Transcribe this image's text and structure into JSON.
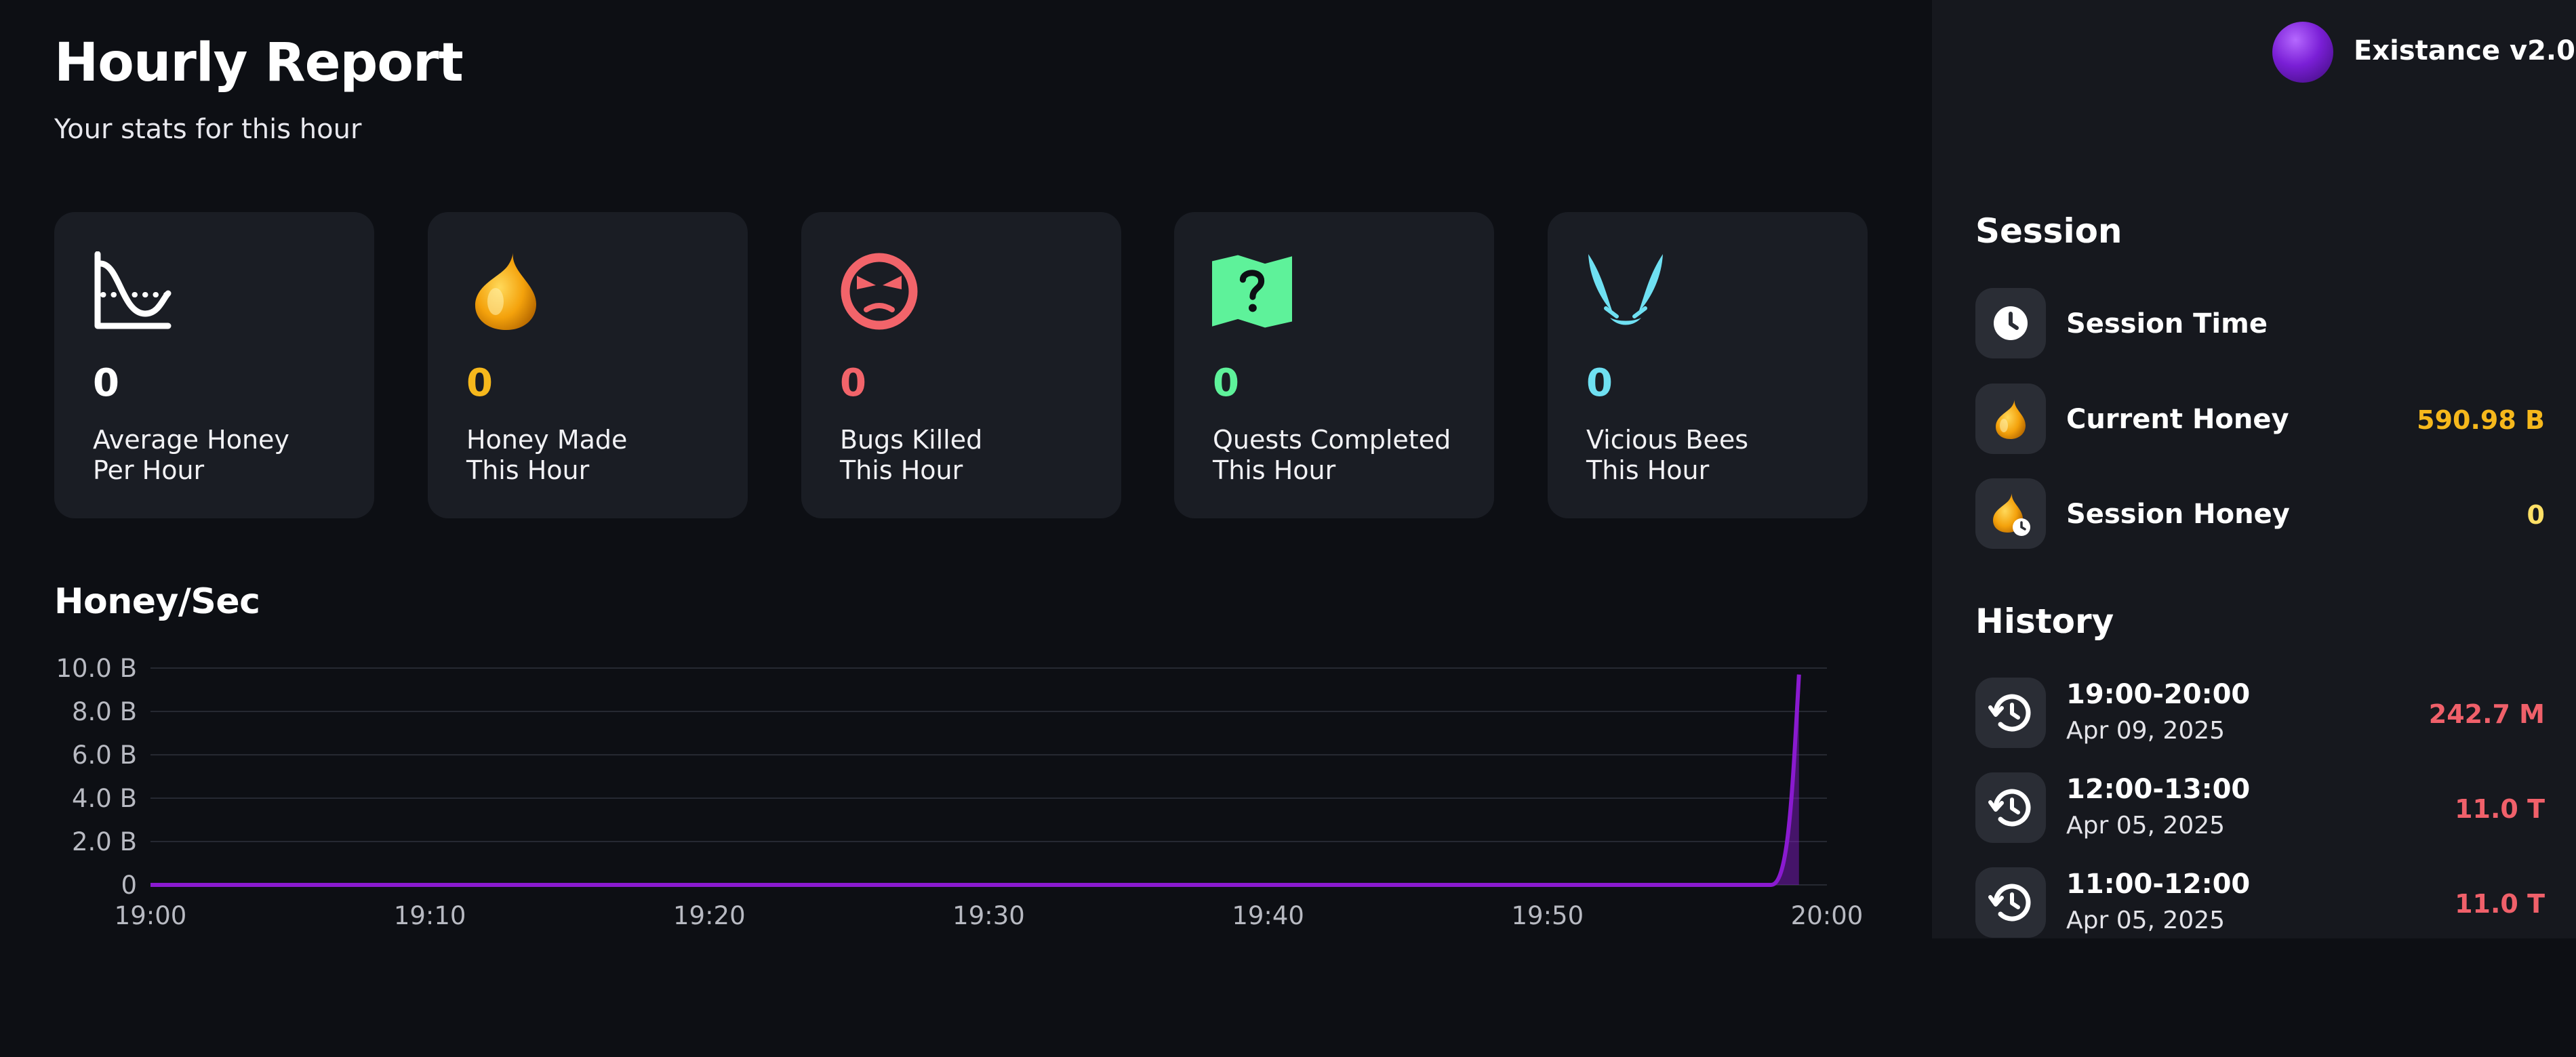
{
  "header": {
    "title": "Hourly Report",
    "subtitle": "Your stats for this hour"
  },
  "cards": [
    {
      "icon": "honey-chart-icon",
      "value": "0",
      "label": "Average Honey\nPer Hour",
      "color": "#ffffff"
    },
    {
      "icon": "honey-drop-icon",
      "value": "0",
      "label": "Honey Made\nThis Hour",
      "color": "#f6b81c"
    },
    {
      "icon": "angry-bug-icon",
      "value": "0",
      "label": "Bugs Killed\nThis Hour",
      "color": "#f2646a"
    },
    {
      "icon": "quest-map-icon",
      "value": "0",
      "label": "Quests Completed\nThis Hour",
      "color": "#5ef29a"
    },
    {
      "icon": "vicious-bee-icon",
      "value": "0",
      "label": "Vicious Bees\nThis Hour",
      "color": "#6fe0f2"
    }
  ],
  "chart_title": "Honey/Sec",
  "chart_data": {
    "type": "area",
    "title": "Honey/Sec",
    "xlabel": "",
    "ylabel": "",
    "x_ticks": [
      "19:00",
      "19:10",
      "19:20",
      "19:30",
      "19:40",
      "19:50",
      "20:00"
    ],
    "y_ticks": [
      "0",
      "2.0 B",
      "4.0 B",
      "6.0 B",
      "8.0 B",
      "10.0 B"
    ],
    "ylim": [
      0,
      10
    ],
    "y_unit": "B",
    "grid": true,
    "series": [
      {
        "color": "#8a1ad0",
        "points": [
          {
            "x": "19:00",
            "y": 0
          },
          {
            "x": "19:58",
            "y": 0
          },
          {
            "x": "19:58:30",
            "y": 2.5
          },
          {
            "x": "19:59",
            "y": 9.7
          }
        ]
      }
    ]
  },
  "sidebar": {
    "brand": "Existance v2.0",
    "session_title": "Session",
    "session": [
      {
        "icon": "clock-icon",
        "label": "Session Time",
        "value": "",
        "color": "#ffffff"
      },
      {
        "icon": "honey-drop-icon",
        "label": "Current Honey",
        "value": "590.98 B",
        "color": "#f6b81c"
      },
      {
        "icon": "honey-clock-icon",
        "label": "Session Honey",
        "value": "0",
        "color": "#ffe066"
      }
    ],
    "history_title": "History",
    "history": [
      {
        "icon": "history-icon",
        "time": "19:00-20:00",
        "date": "Apr 09, 2025",
        "value": "242.7 M"
      },
      {
        "icon": "history-icon",
        "time": "12:00-13:00",
        "date": "Apr 05, 2025",
        "value": "11.0 T"
      },
      {
        "icon": "history-icon",
        "time": "11:00-12:00",
        "date": "Apr 05, 2025",
        "value": "11.0 T"
      }
    ]
  }
}
